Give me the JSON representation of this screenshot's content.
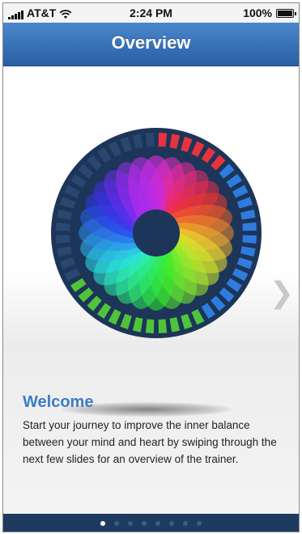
{
  "status_bar": {
    "carrier": "AT&T",
    "time": "2:24 PM",
    "battery": "100%"
  },
  "nav": {
    "title": "Overview"
  },
  "welcome": {
    "title": "Welcome",
    "body": "Start your journey to improve the inner balance between your mind and heart by swiping through the next few slides for an overview of the trainer."
  },
  "pager": {
    "total": 8,
    "current": 1
  },
  "colors": {
    "nav_blue": "#2f68b0",
    "title_blue": "#3d7cc7",
    "ring_dark": "#1d3558",
    "segment_red": "#e8333f",
    "segment_blue": "#2f7ce0",
    "segment_green": "#4fc43a",
    "pager_bg": "#1f3a5f"
  },
  "icons": [
    "signal-bars-icon",
    "wifi-icon",
    "battery-icon",
    "chevron-right-icon",
    "color-wheel-graphic"
  ]
}
